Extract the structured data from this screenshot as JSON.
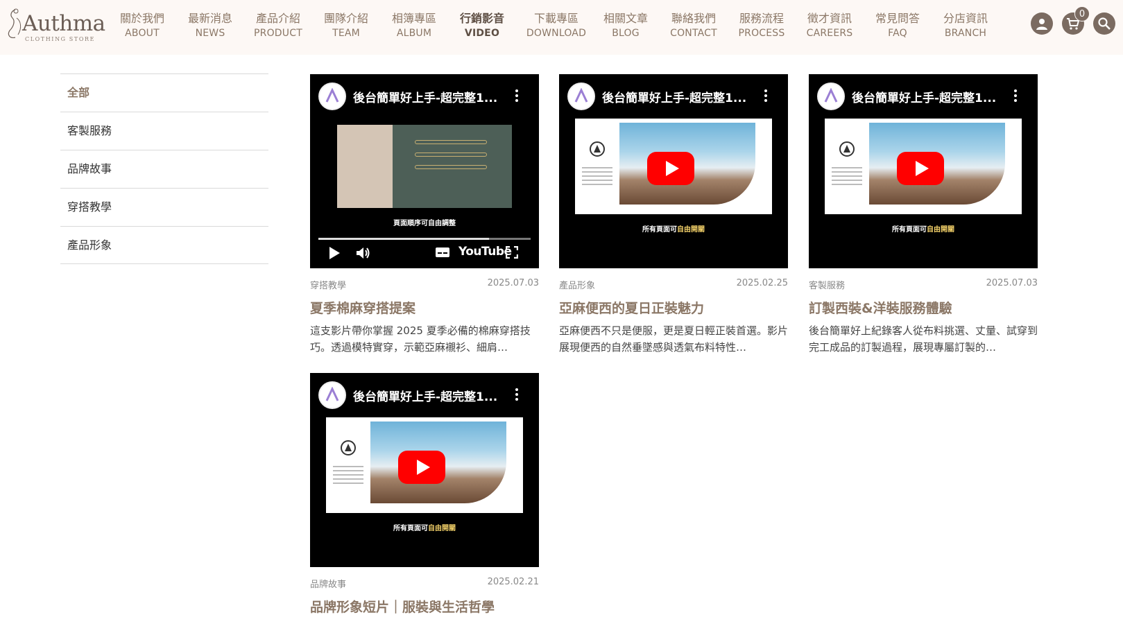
{
  "brand": {
    "name": "Authma",
    "tagline": "CLOTHING STORE"
  },
  "nav": [
    {
      "zh": "關於我們",
      "en": "ABOUT"
    },
    {
      "zh": "最新消息",
      "en": "NEWS"
    },
    {
      "zh": "產品介紹",
      "en": "PRODUCT"
    },
    {
      "zh": "團隊介紹",
      "en": "TEAM"
    },
    {
      "zh": "相簿專區",
      "en": "ALBUM"
    },
    {
      "zh": "行銷影音",
      "en": "VIDEO"
    },
    {
      "zh": "下載專區",
      "en": "DOWNLOAD"
    },
    {
      "zh": "相關文章",
      "en": "BLOG"
    },
    {
      "zh": "聯絡我們",
      "en": "CONTACT"
    },
    {
      "zh": "服務流程",
      "en": "PROCESS"
    },
    {
      "zh": "徵才資訊",
      "en": "CAREERS"
    },
    {
      "zh": "常見問答",
      "en": "FAQ"
    },
    {
      "zh": "分店資訊",
      "en": "BRANCH"
    }
  ],
  "active_nav": "VIDEO",
  "cart": {
    "count": "0"
  },
  "colors": {
    "accent": "#8b7766",
    "header_bg": "#fdf8f5",
    "icon_bg": "#7b6b61"
  },
  "icons": {
    "user": "user-icon",
    "cart": "cart-icon",
    "search": "search-icon"
  },
  "sidebar": [
    {
      "label": "全部"
    },
    {
      "label": "客製服務"
    },
    {
      "label": "品牌故事"
    },
    {
      "label": "穿搭教學"
    },
    {
      "label": "產品形象"
    }
  ],
  "videos": [
    {
      "yt_title": "後台簡單好上手-超完整1...",
      "caption": "頁面順序可自由調整",
      "category": "穿搭教學",
      "date": "2025.07.03",
      "title": "夏季棉麻穿搭提案",
      "desc": "這支影片帶你掌握 2025 夏季必備的棉麻穿搭技巧。透過模特實穿，示範亞麻襯衫、細肩…",
      "youtube_label": "YouTube"
    },
    {
      "yt_title": "後台簡單好上手-超完整1...",
      "caption_pre": "所有頁面可",
      "caption_hl": "自由開關",
      "category": "產品形象",
      "date": "2025.02.25",
      "title": "亞麻便西的夏日正裝魅力",
      "desc": "亞麻便西不只是便服，更是夏日輕正裝首選。影片展現便西的自然垂墜感與透氣布料特性…"
    },
    {
      "yt_title": "後台簡單好上手-超完整1...",
      "caption_pre": "所有頁面可",
      "caption_hl": "自由開關",
      "category": "客製服務",
      "date": "2025.07.03",
      "title": "訂製西裝&洋裝服務體驗",
      "desc": "後台簡單好上紀錄客人從布料挑選、丈量、試穿到完工成品的訂製過程，展現專屬訂製的…"
    },
    {
      "yt_title": "後台簡單好上手-超完整1...",
      "caption_pre": "所有頁面可",
      "caption_hl": "自由開關",
      "category": "品牌故事",
      "date": "2025.02.21",
      "title": "品牌形象短片｜服裝與生活哲學",
      "desc": ""
    }
  ]
}
